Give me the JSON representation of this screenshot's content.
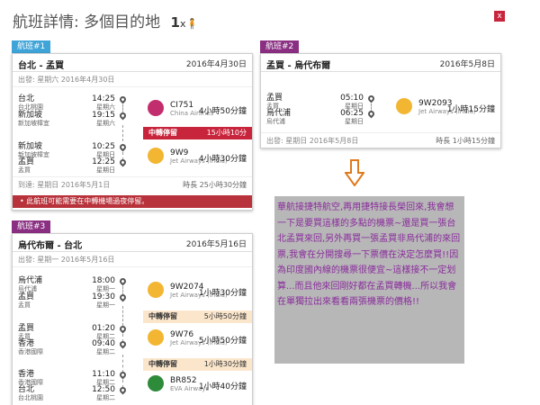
{
  "header": {
    "title": "航班詳情: 多個目的地",
    "passengers": "1",
    "passenger_x": "x",
    "close_label": "x"
  },
  "flight1": {
    "tag": "航班#1",
    "route": "台北 - 孟買",
    "date": "2016年4月30日",
    "depart": "出發: 星期六 2016年4月30日",
    "seg1": {
      "from": "台北",
      "from_sub": "台北桃園",
      "dep_time": "14:25",
      "dep_day": "星期六",
      "to": "新加坡",
      "to_sub": "新加坡樟宜",
      "arr_time": "19:15",
      "arr_day": "星期六",
      "flight_no": "CI751",
      "airline": "China Airlines",
      "duration": "4小時50分鐘"
    },
    "layover": {
      "label": "中轉停留",
      "duration": "15小時10分"
    },
    "seg2": {
      "from": "新加坡",
      "from_sub": "新加坡樟宜",
      "dep_time": "10:25",
      "dep_day": "星期日",
      "to": "孟買",
      "to_sub": "孟買",
      "arr_time": "12:25",
      "arr_day": "星期日",
      "flight_no": "9W9",
      "airline": "Jet Airways (India)",
      "duration": "4小時30分鐘"
    },
    "arrive": "到達: 星期日 2016年5月1日",
    "total": "時長 25小時30分鐘",
    "warning": "• 此航班可能需要在中轉機場過夜停留。"
  },
  "flight2": {
    "tag": "航班#2",
    "route": "孟買 - 烏代布爾",
    "date": "2016年5月8日",
    "seg1": {
      "from": "孟買",
      "from_sub": "孟買",
      "dep_time": "05:10",
      "dep_day": "星期日",
      "to": "烏代浦",
      "to_sub": "烏代浦",
      "arr_time": "06:25",
      "arr_day": "星期日",
      "flight_no": "9W2093",
      "airline": "Jet Airways (India)",
      "duration": "1小時15分鐘"
    },
    "depart": "出發: 星期日 2016年5月8日",
    "total": "時長 1小時15分鐘"
  },
  "flight3": {
    "tag": "航班#3",
    "route": "烏代布爾 - 台北",
    "date": "2016年5月16日",
    "depart": "出發: 星期一 2016年5月16日",
    "seg1": {
      "from": "烏代浦",
      "from_sub": "烏代浦",
      "dep_time": "18:00",
      "dep_day": "星期一",
      "to": "孟買",
      "to_sub": "孟買",
      "arr_time": "19:30",
      "arr_day": "星期一",
      "flight_no": "9W2074",
      "airline": "Jet Airways (India)",
      "duration": "1小時30分鐘"
    },
    "layover1": {
      "label": "中轉停留",
      "duration": "5小時50分鐘"
    },
    "seg2": {
      "from": "孟買",
      "from_sub": "孟買",
      "dep_time": "01:20",
      "dep_day": "星期二",
      "to": "香港",
      "to_sub": "香港國際",
      "arr_time": "09:40",
      "arr_day": "星期二",
      "flight_no": "9W76",
      "airline": "Jet Airways (India)",
      "duration": "5小時50分鐘"
    },
    "layover2": {
      "label": "中轉停留",
      "duration": "1小時30分鐘"
    },
    "seg3": {
      "from": "香港",
      "from_sub": "香港國際",
      "dep_time": "11:10",
      "dep_day": "星期二",
      "to": "台北",
      "to_sub": "台北桃園",
      "arr_time": "12:50",
      "arr_day": "星期二",
      "flight_no": "BR852",
      "airline": "EVA Airways",
      "duration": "1小時40分鐘"
    }
  },
  "comment": "華航接捷特航空,再用捷特接長榮回來,我會想一下是要買這樣的多點的機票~還是買一張台北孟買來回,另外再買一張孟買非烏代浦的來回票,我會在分開搜尋一下票價在決定怎麼買!!因為印度國內線的機票很便宜~這樣接不一定划算...而且他來回剛好都在孟買轉機...所以我會在單獨拉出來看看兩張機票的價格!!",
  "colors": {
    "accent": "#c8243c",
    "tag_blue": "#3fa4d8",
    "tag_purple": "#8a2f82",
    "layover": "#fbe6cc",
    "comment_text": "#8a2c9c"
  }
}
